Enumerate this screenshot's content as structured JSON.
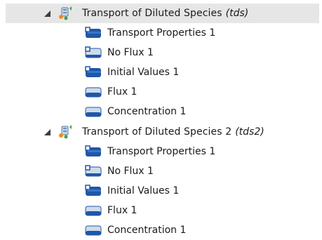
{
  "tree": {
    "physics": [
      {
        "name": "Transport of Diluted Species",
        "tag": "(tds)",
        "children": [
          {
            "label": "Transport Properties 1",
            "kind": "domain"
          },
          {
            "label": "No Flux 1",
            "kind": "boundary-default"
          },
          {
            "label": "Initial Values 1",
            "kind": "domain"
          },
          {
            "label": "Flux 1",
            "kind": "boundary"
          },
          {
            "label": "Concentration 1",
            "kind": "boundary"
          }
        ]
      },
      {
        "name": "Transport of Diluted Species 2",
        "tag": "(tds2)",
        "children": [
          {
            "label": "Transport Properties 1",
            "kind": "domain"
          },
          {
            "label": "No Flux 1",
            "kind": "boundary-default"
          },
          {
            "label": "Initial Values 1",
            "kind": "domain"
          },
          {
            "label": "Flux 1",
            "kind": "boundary"
          },
          {
            "label": "Concentration 1",
            "kind": "boundary"
          }
        ]
      }
    ]
  },
  "icons": {
    "expand": "expanded-triangle-icon",
    "physics": "transport-physics-icon",
    "domain": "domain-feature-icon",
    "boundary": "boundary-feature-icon",
    "boundary_default": "boundary-default-feature-icon"
  },
  "colors": {
    "selected_row": "#e6e6e6",
    "feature_blue": "#1f57a8",
    "feature_light": "#cfdbe9",
    "physics_green": "#3aa53a",
    "physics_orange": "#f28a1e"
  }
}
